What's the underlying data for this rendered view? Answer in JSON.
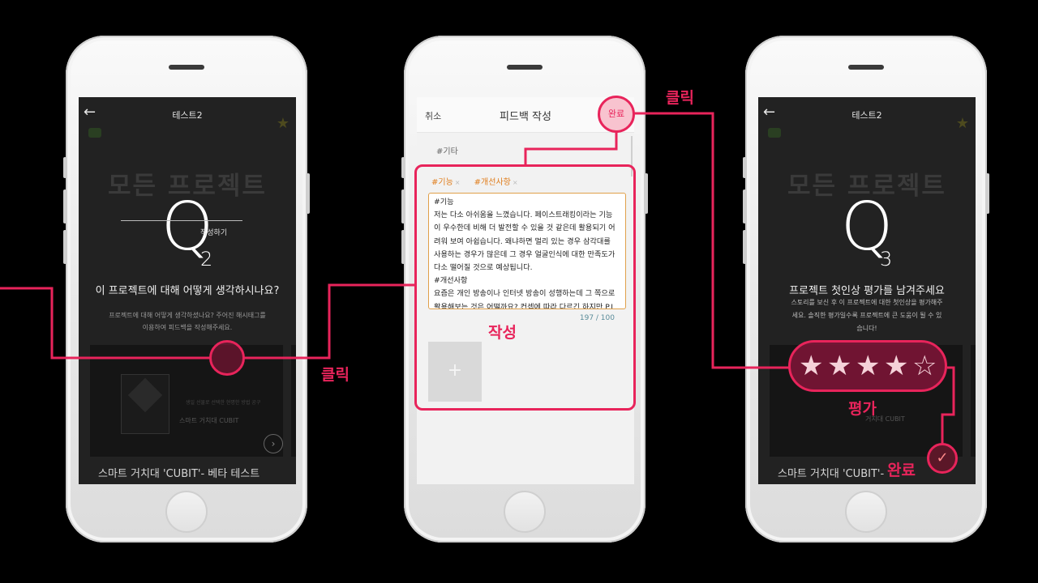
{
  "colors": {
    "accent": "#e8245b",
    "tag": "#e07e1d",
    "counter": "#5a8c9a"
  },
  "left_screen": {
    "top_title": "테스트2",
    "back_icon": "←",
    "background_headline": "모든 프로젝트",
    "q_letter": "Q",
    "q_number": "2",
    "question": "이 프로젝트에 대해 어떻게 생각하시나요?",
    "description": "프로젝트에 대해 어떻게 생각하셨나요? 주어진 해시태그를 이용하여 피드백을 작성해주세요.",
    "write_label": "작성하기",
    "card_small_text": "생일 선물로 선택한 현명한 방법 공구",
    "card_text": "스마트 거치대 CUBIT",
    "project_title": "스마트 거치대 'CUBIT'- 베타 테스트"
  },
  "middle_screen": {
    "cancel": "취소",
    "title": "피드백 작성",
    "done": "완료",
    "etc_tag": "#기타",
    "tags": [
      "#기능",
      "#개선사항"
    ],
    "tag_remove": "×",
    "text_lines": [
      "#기능",
      "저는 다소 아쉬움을 느꼈습니다. 페이스트래킹이라는 기능",
      "이 우수한데 비해 더 발전할 수 있을 것 같은데 활용되기 어",
      "려워 보여 아쉽습니다. 왜냐하면 멀리 있는 경우 삼각대를",
      "사용하는 경우가 많은데 그 경우 얼굴인식에 대한 만족도가",
      "다소 떨어질 것으로 예상됩니다.",
      "#개선사항",
      "요즘은 개인 방송이나 인터넷 방송이 성행하는데 그 쪽으로",
      "활용해보는 것은 어떨까요? 컨셉에 따라 다르긴 하지만 P.I"
    ],
    "counter": "197 / 100",
    "add_photo": "+"
  },
  "right_screen": {
    "top_title": "테스트2",
    "back_icon": "←",
    "background_headline": "모든 프로젝트",
    "q_letter": "Q",
    "q_number": "3",
    "rating_prompt": "프로젝트 첫인상 평가를 남겨주세요",
    "description": "스토리를 보신 후 이 프로젝트에 대한 첫인상을 평가해주세요. 솔직한 평가일수록 프로젝트에 큰 도움이 될 수 있습니다!",
    "card_text": "거치대 CUBIT",
    "project_title": "스마트 거치대 'CUBIT'-",
    "rating": 4,
    "rating_max": 5
  },
  "annotations": {
    "click_left": "클릭",
    "click_right": "클릭",
    "write": "작성",
    "rate": "평가",
    "done": "완료",
    "done_pill": "완료"
  }
}
